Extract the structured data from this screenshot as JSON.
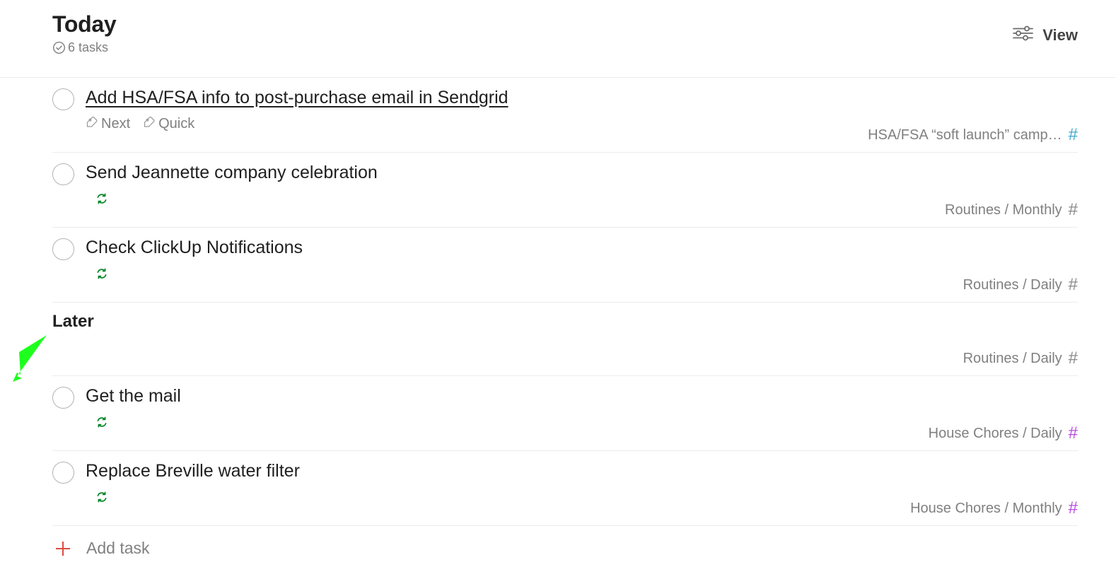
{
  "header": {
    "title": "Today",
    "count_text": "6 tasks",
    "count_icon": "check-circle-icon",
    "view_label": "View",
    "view_icon": "sliders-icon"
  },
  "colors": {
    "text_primary": "#202020",
    "text_secondary": "#808080",
    "divider": "#ececec",
    "hash_blue": "#3ea8d0",
    "hash_purple": "#b84ae0",
    "hash_gray": "#808080",
    "recurring_green": "#058527",
    "add_red": "#db4c3f",
    "cursor_green": "#1eff1e"
  },
  "sections": [
    {
      "name": "today-section",
      "heading": null,
      "tasks": [
        {
          "title": "Add HSA/FSA info to post-purchase email in Sendgrid",
          "underlined": true,
          "recurring": false,
          "labels": [
            {
              "text": "Next",
              "icon": "tag-icon"
            },
            {
              "text": "Quick",
              "icon": "tag-icon"
            }
          ],
          "project": "HSA/FSA “soft launch” camp…",
          "hash_color": "#3ea8d0"
        },
        {
          "title": "Send Jeannette company celebration",
          "underlined": false,
          "recurring": true,
          "labels": [],
          "project": "Routines / Monthly",
          "hash_color": "#808080"
        },
        {
          "title": "Check ClickUp Notifications",
          "underlined": false,
          "recurring": true,
          "labels": [],
          "project": "Routines / Daily",
          "hash_color": "#808080"
        }
      ]
    },
    {
      "name": "later-section",
      "heading": "Later",
      "heading_row_project": "Routines / Daily",
      "heading_row_hash_color": "#808080",
      "tasks": [
        {
          "title": "Get the mail",
          "underlined": false,
          "recurring": true,
          "labels": [],
          "project": "House Chores / Daily",
          "hash_color": "#b84ae0"
        },
        {
          "title": "Replace Breville water filter",
          "underlined": false,
          "recurring": true,
          "labels": [],
          "project": "House Chores / Monthly",
          "hash_color": "#b84ae0"
        }
      ]
    }
  ],
  "footer": {
    "add_task_label": "Add task",
    "add_task_icon": "plus-icon"
  }
}
